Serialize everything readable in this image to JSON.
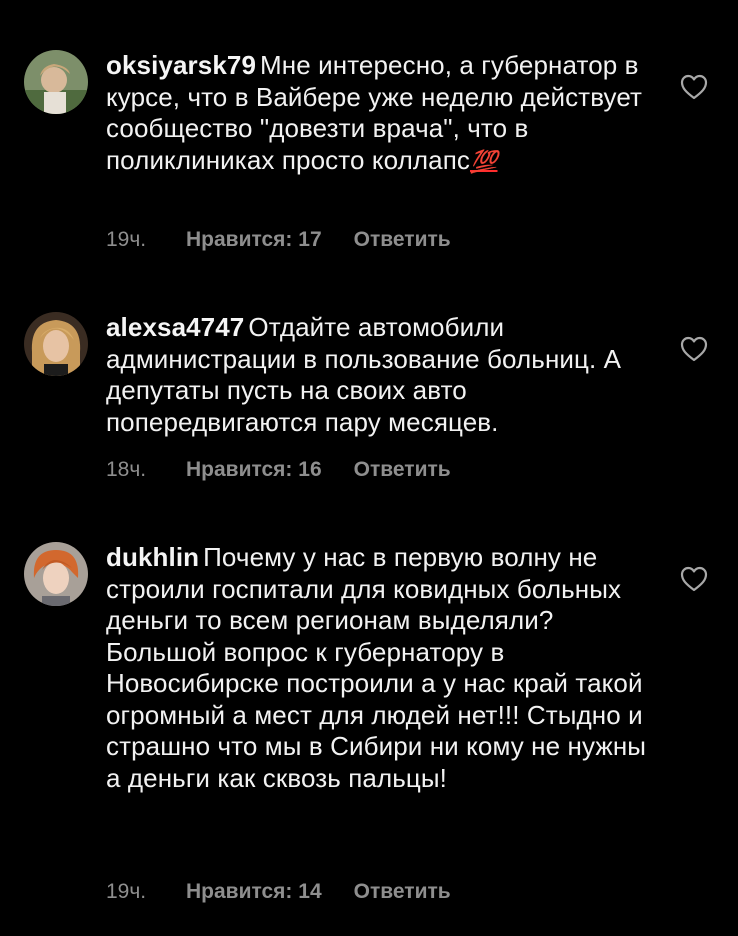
{
  "comments": [
    {
      "username": "oksiyarsk79",
      "text": "Мне интересно, а губернатор в курсе, что в Вайбере уже неделю действует сообщество \"довезти врача\", что в поликлиниках просто коллапс",
      "emoji": "💯",
      "time": "19ч.",
      "likes": "Нравится: 17",
      "reply": "Ответить"
    },
    {
      "username": "alexsa4747",
      "text": "Отдайте автомобили администрации в пользование больниц. А депутаты пусть на своих авто попередвигаются пару месяцев.",
      "time": "18ч.",
      "likes": "Нравится: 16",
      "reply": "Ответить"
    },
    {
      "username": "dukhlin",
      "text": "Почему у нас в первую волну не строили госпитали для ковидных больных деньги то всем регионам выделяли? Большой вопрос к губернатору в Новосибирске построили а у нас край такой огромный а мест для людей нет!!! Стыдно и страшно что мы в Сибири ни кому не нужны а деньги как сквозь пальцы!",
      "time": "19ч.",
      "likes": "Нравится: 14",
      "reply": "Ответить"
    }
  ],
  "icons": {
    "like": "heart-outline-icon"
  },
  "colors": {
    "background": "#000000",
    "text": "#f2f2f2",
    "meta": "#8e8e8e"
  }
}
